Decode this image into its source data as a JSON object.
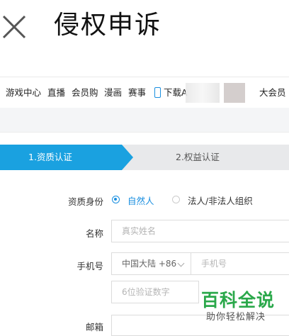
{
  "header": {
    "title": "侵权申诉",
    "close_icon": "close-icon"
  },
  "nav": {
    "items": [
      "游戏中心",
      "直播",
      "会员购",
      "漫画",
      "赛事",
      "下载A",
      "大会员"
    ],
    "download_icon": "phone-icon",
    "accent": "#1a8fe0"
  },
  "steps": {
    "step1": "1.资质认证",
    "step2": "2.权益认证",
    "active_color": "#1aa1e0"
  },
  "form": {
    "identity_label": "资质身份",
    "identity_options": [
      "自然人",
      "法人/非法人组织"
    ],
    "identity_selected": "自然人",
    "name_label": "名称",
    "name_placeholder": "真实姓名",
    "phone_label": "手机号",
    "country_code": "中国大陆 +86",
    "phone_placeholder": "手机号",
    "code_placeholder": "6位验证数字",
    "email_label": "邮箱"
  },
  "watermark": {
    "main": "百科全说",
    "sub": "助你轻松解决",
    "color": "#2aa84a"
  }
}
